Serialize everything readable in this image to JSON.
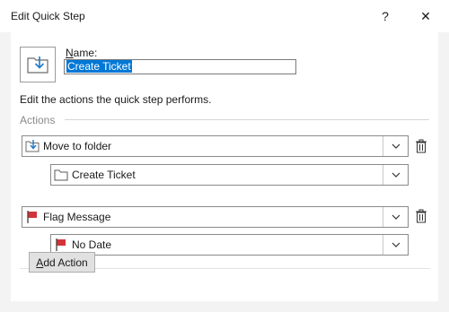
{
  "window": {
    "title": "Edit Quick Step",
    "help_label": "?",
    "close_label": "✕"
  },
  "header": {
    "name_label_accel": "N",
    "name_label_rest": "ame:",
    "name_value": "Create Ticket"
  },
  "description": "Edit the actions the quick step performs.",
  "actions_section_label": "Actions",
  "actions": [
    {
      "label": "Move to folder",
      "icon": "move-to-folder-icon",
      "sub_label": "Create Ticket",
      "sub_icon": "folder-icon"
    },
    {
      "label": "Flag Message",
      "icon": "red-flag-icon",
      "sub_label": "No Date",
      "sub_icon": "red-flag-icon"
    }
  ],
  "add_action": {
    "accel": "A",
    "rest": "dd Action"
  },
  "colors": {
    "flag": "#d13438",
    "selection": "#0078d7",
    "icon_blue": "#1e78c8"
  }
}
